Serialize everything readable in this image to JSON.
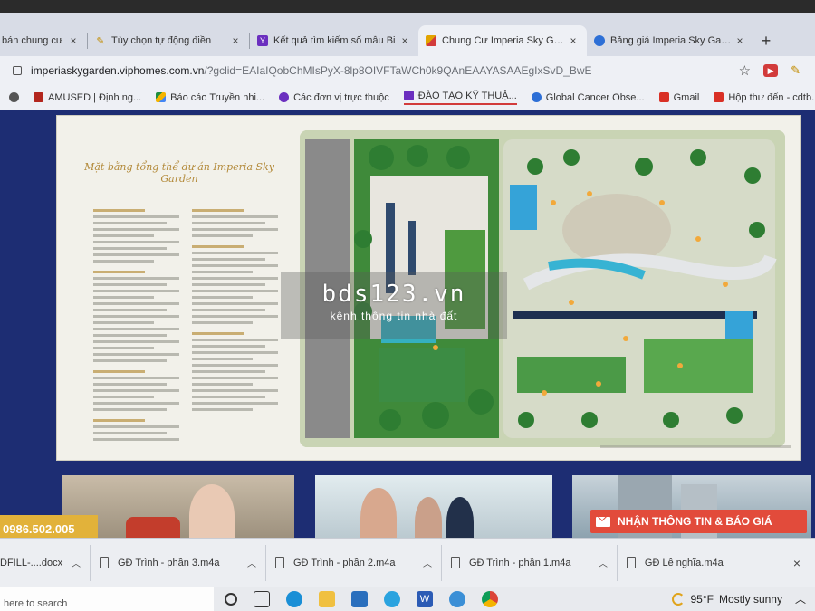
{
  "browser": {
    "tabs": [
      {
        "label": "bán chung cư",
        "favicon": "document-icon",
        "active": false,
        "color": "#7a7a7a"
      },
      {
        "label": "Tùy chọn tự động điền",
        "favicon": "pen-icon",
        "active": false,
        "color": "#c28c00"
      },
      {
        "label": "Kết quả tìm kiếm số mẫu Bi",
        "favicon": "yahoo-icon",
        "active": false,
        "color": "#6b2fbf"
      },
      {
        "label": "Chung Cư Imperia Sky Garde",
        "favicon": "site-icon",
        "active": true,
        "color": "#e2a400"
      },
      {
        "label": "Bảng giá Imperia Sky Garden",
        "favicon": "search-icon",
        "active": false,
        "color": "#2d6fd6"
      }
    ],
    "new_tab_symbol": "+",
    "address": {
      "host": "imperiaskygarden.viphomes.com.vn",
      "rest": "/?gclid=EAIaIQobChMIsPyX-8lp8OIVFTaWCh0k9QAnEAAYASAAEgIxSvD_BwE"
    },
    "bookmarks": [
      {
        "label": "",
        "icon": "globe-icon",
        "color": "#555"
      },
      {
        "label": "AMUSED | Định ng...",
        "icon": "shield-icon",
        "color": "#b3261e"
      },
      {
        "label": "Báo cáo Truyền nhi...",
        "icon": "drive-icon",
        "color": "#1e8e3e"
      },
      {
        "label": "Các đơn vị trực thuộc",
        "icon": "circle-icon",
        "color": "#6b2fbf"
      },
      {
        "label": "ĐÀO TẠO KỸ THUẬ...",
        "icon": "square-icon",
        "color": "#6b2fbf"
      },
      {
        "label": "Global Cancer Obse...",
        "icon": "globe-icon",
        "color": "#2d6fd6"
      },
      {
        "label": "Gmail",
        "icon": "gmail-icon",
        "color": "#d93025"
      },
      {
        "label": "Hộp thư đến - cdtb...",
        "icon": "gmail-icon",
        "color": "#d93025"
      }
    ]
  },
  "page": {
    "masterplan_title": "Mặt bằng tổng thể dự án Imperia Sky Garden",
    "watermark": {
      "brand": "bds123.vn",
      "tagline": "kênh thông tin nhà đất"
    },
    "phone": "0986.502.005",
    "cta": "NHẬN THÔNG TIN & BÁO GIÁ"
  },
  "downloads": [
    {
      "name": "DFILL-....docx"
    },
    {
      "name": "GĐ Trình - phần 3.m4a"
    },
    {
      "name": "GĐ Trình - phần 2.m4a"
    },
    {
      "name": "GĐ Trình - phần 1.m4a"
    },
    {
      "name": "GĐ Lê nghĩa.m4a"
    }
  ],
  "taskbar": {
    "search_placeholder": "here to search",
    "weather_temp": "95°F",
    "weather_text": "Mostly sunny"
  }
}
